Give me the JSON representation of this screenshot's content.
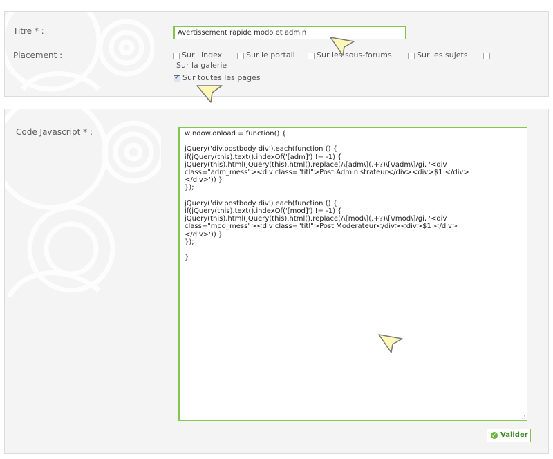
{
  "form": {
    "title_label": "Titre * :",
    "title_value": "Avertissement rapide modo et admin",
    "placement_label": "Placement :",
    "placement_options": [
      {
        "label": "Sur l'index",
        "checked": false
      },
      {
        "label": "Sur le portail",
        "checked": false
      },
      {
        "label": "Sur les sous-forums",
        "checked": false
      },
      {
        "label": "Sur les sujets",
        "checked": false
      },
      {
        "label": "Sur la galerie",
        "checked": false
      },
      {
        "label": "Sur toutes les pages",
        "checked": true
      }
    ],
    "code_label": "Code Javascript * :",
    "code_value": "window.onload = function() {\n\njQuery('div.postbody div').each(function () {\nif(jQuery(this).text().indexOf('[adm]') != -1) {\njQuery(this).html(jQuery(this).html().replace(/\\[adm\\](.+?)\\[\\/adm\\]/gi, '<div\nclass=\"adm_mess\"><div class=\"titl\">Post Administrateur</div><div>$1 </div>\n</div>')) }\n});\n\njQuery('div.postbody div').each(function () {\nif(jQuery(this).text().indexOf('[mod]') != -1) {\njQuery(this).html(jQuery(this).html().replace(/\\[mod\\](.+?)\\[\\/mod\\]/gi, '<div\nclass=\"mod_mess\"><div class=\"titl\">Post Modérateur</div><div>$1 </div>\n</div>')) }\n});\n\n}",
    "submit_label": "Valider"
  },
  "colors": {
    "accent": "#86c44f",
    "panel_bg": "#f4f4f4",
    "cursor_fill": "#fff7b8"
  }
}
